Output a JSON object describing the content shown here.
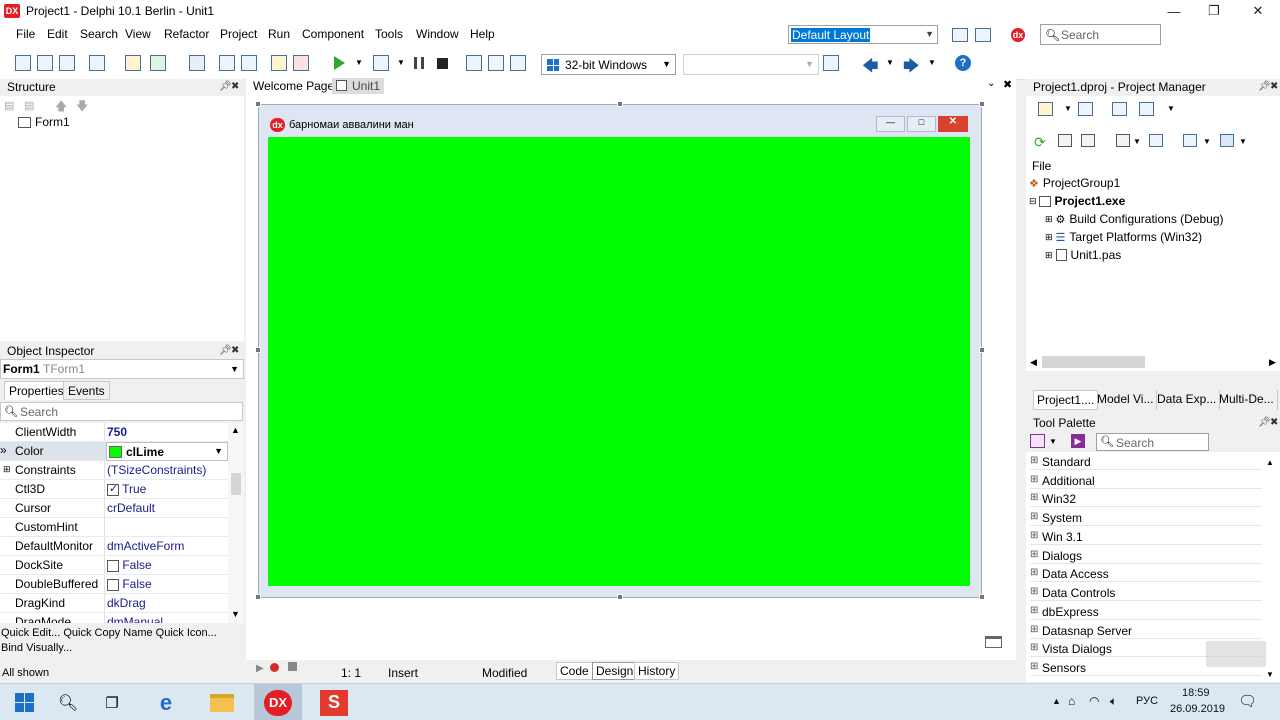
{
  "window": {
    "title": "Project1 - Delphi 10.1 Berlin - Unit1",
    "logo": "DX"
  },
  "menu": [
    "File",
    "Edit",
    "Search",
    "View",
    "Refactor",
    "Project",
    "Run",
    "Component",
    "Tools",
    "Window",
    "Help"
  ],
  "layout_combo": {
    "value": "Default Layout"
  },
  "search_top": {
    "placeholder": "Search"
  },
  "toolbar": {
    "platform": "32-bit Windows"
  },
  "structure": {
    "title": "Structure",
    "root": "Form1"
  },
  "object_inspector": {
    "title": "Object Inspector",
    "selected": "Form1",
    "selected_type": "TForm1",
    "tabs": [
      "Properties",
      "Events"
    ],
    "search_placeholder": "Search",
    "properties": [
      {
        "name": "ClientWidth",
        "value": "750"
      },
      {
        "name": "Color",
        "value": "clLime"
      },
      {
        "name": "Constraints",
        "value": "(TSizeConstraints)"
      },
      {
        "name": "Ctl3D",
        "value": "True"
      },
      {
        "name": "Cursor",
        "value": "crDefault"
      },
      {
        "name": "CustomHint",
        "value": ""
      },
      {
        "name": "DefaultMonitor",
        "value": "dmActiveForm"
      },
      {
        "name": "DockSite",
        "value": "False"
      },
      {
        "name": "DoubleBuffered",
        "value": "False"
      },
      {
        "name": "DragKind",
        "value": "dkDrag"
      },
      {
        "name": "DragMode",
        "value": "dmManual"
      }
    ],
    "footer_line1": "Quick Edit...  Quick Copy Name  Quick Icon...",
    "footer_line2": "Bind Visually...",
    "status": "All shown"
  },
  "designer": {
    "tabs": [
      "Welcome Page",
      "Unit1"
    ],
    "form_caption": "барномаи  аввалини ман",
    "form_color": "#00ff00"
  },
  "editor_status": {
    "position": "1:   1",
    "mode": "Insert",
    "state": "Modified",
    "views": [
      "Code",
      "Design",
      "History"
    ]
  },
  "project_manager": {
    "title": "Project1.dproj - Project Manager",
    "file_label": "File",
    "group": "ProjectGroup1",
    "project": "Project1.exe",
    "items": [
      "Build Configurations (Debug)",
      "Target Platforms (Win32)",
      "Unit1.pas"
    ],
    "tabs": [
      "Project1....",
      "Model Vi...",
      "Data Exp...",
      "Multi-De..."
    ]
  },
  "tool_palette": {
    "title": "Tool Palette",
    "search_placeholder": "Search",
    "categories": [
      "Standard",
      "Additional",
      "Win32",
      "System",
      "Win 3.1",
      "Dialogs",
      "Data Access",
      "Data Controls",
      "dbExpress",
      "Datasnap Server",
      "Vista Dialogs",
      "Sensors"
    ]
  },
  "taskbar": {
    "lang": "РУС",
    "time": "18:59",
    "date": "26.09.2019"
  }
}
